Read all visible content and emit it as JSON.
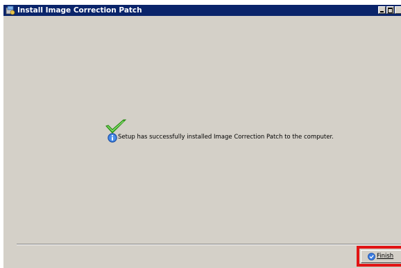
{
  "window": {
    "title": "Install Image Correction Patch"
  },
  "content": {
    "message": "Setup has successfully installed Image Correction Patch to the computer."
  },
  "footer": {
    "finish_label": "Finish"
  },
  "colors": {
    "titlebar": "#0a246a",
    "window_bg": "#d4d0c8",
    "highlight": "#e11414",
    "check_green": "#3cb521"
  },
  "icons": {
    "title_icon": "installer-icon",
    "success_icon": "checkmark-icon",
    "info_icon": "info-icon",
    "finish_icon": "finish-icon"
  }
}
